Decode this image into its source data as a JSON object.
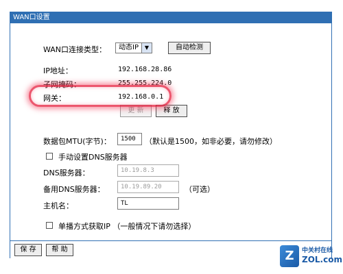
{
  "window": {
    "title": "WAN口设置"
  },
  "connection": {
    "label": "WAN口连接类型：",
    "selected": "动态IP",
    "detect_button": "自动检测"
  },
  "info": {
    "ip_label": "IP地址：",
    "ip_value": "192.168.28.86",
    "mask_label": "子网掩码：",
    "mask_value": "255.255.224.0",
    "gateway_label": "网关：",
    "gateway_value": "192.168.0.1"
  },
  "actions": {
    "renew": "更 新",
    "release": "释 放"
  },
  "mtu": {
    "label": "数据包MTU(字节)：",
    "value": "1500",
    "hint": "（默认是1500，如非必要，请勿修改）"
  },
  "dns": {
    "manual_label": "手动设置DNS服务器",
    "primary_label": "DNS服务器：",
    "primary_value": "10.19.8.3",
    "secondary_label": "备用DNS服务器：",
    "secondary_value": "10.19.89.20",
    "optional": "（可选）"
  },
  "host": {
    "label": "主机名：",
    "value": "TL"
  },
  "unicast": {
    "label": "单播方式获取IP （一般情况下请勿选择）"
  },
  "footer": {
    "save": "保 存",
    "help": "帮 助"
  },
  "watermark": {
    "cn": "中关村在线",
    "en": "ZOL.com.cn",
    "logo": "Z"
  }
}
